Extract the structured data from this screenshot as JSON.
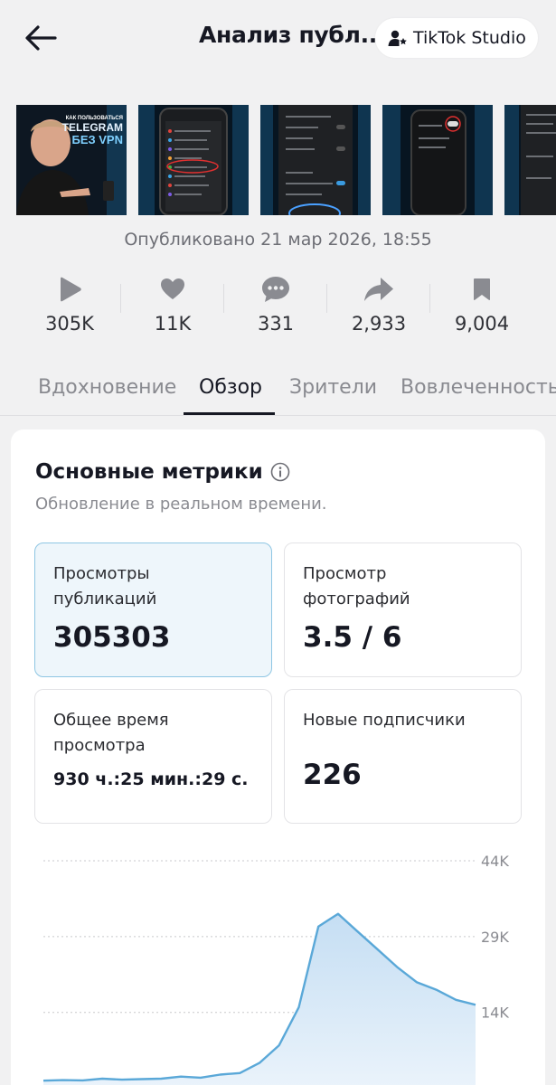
{
  "header": {
    "title": "Анализ публ...",
    "studio_label": "TikTok Studio"
  },
  "thumbnails": [
    {
      "lines": [
        "КАК ПОЛЬЗОВАТЬСЯ",
        "TELEGRAM",
        "БЕЗ VPN"
      ]
    },
    {
      "lines": []
    },
    {
      "lines": []
    },
    {
      "lines": []
    },
    {
      "lines": []
    }
  ],
  "published": "Опубликовано 21 мар 2026, 18:55",
  "stats": [
    {
      "icon": "play-icon",
      "value": "305K"
    },
    {
      "icon": "heart-icon",
      "value": "11K"
    },
    {
      "icon": "comment-icon",
      "value": "331"
    },
    {
      "icon": "share-icon",
      "value": "2,933"
    },
    {
      "icon": "bookmark-icon",
      "value": "9,004"
    }
  ],
  "tabs": [
    {
      "label": "Вдохновение",
      "active": false
    },
    {
      "label": "Обзор",
      "active": true
    },
    {
      "label": "Зрители",
      "active": false
    },
    {
      "label": "Вовлеченность",
      "active": false
    }
  ],
  "metrics_card": {
    "title": "Основные метрики",
    "subtitle": "Обновление в реальном времени.",
    "metrics": [
      {
        "label_line1": "Просмотры",
        "label_line2": "публикаций",
        "value": "305303",
        "selected": true
      },
      {
        "label_line1": "Просмотр",
        "label_line2": "фотографий",
        "value": "3.5 / 6",
        "selected": false
      },
      {
        "label_line1": "Общее время",
        "label_line2": "просмотра",
        "value": "930 ч.:25 мин.:29 с.",
        "selected": false
      },
      {
        "label_line1": "Новые подписчики",
        "label_line2": "",
        "value": "226",
        "selected": false
      }
    ]
  },
  "chart_data": {
    "type": "area",
    "title": "",
    "xlabel": "",
    "ylabel": "",
    "y_ticks": [
      "44K",
      "29K",
      "14K"
    ],
    "y_tick_values": [
      44000,
      29000,
      14000
    ],
    "ylim": [
      0,
      44000
    ],
    "color": "#5aa8d8",
    "fill": "#d6e8f6",
    "series": [
      {
        "values": [
          500,
          600,
          550,
          900,
          700,
          800,
          900,
          1300,
          1100,
          1700,
          2000,
          4000,
          7500,
          15000,
          31000,
          33500,
          30000,
          26500,
          23000,
          20000,
          18500,
          16500,
          15500
        ]
      }
    ]
  }
}
